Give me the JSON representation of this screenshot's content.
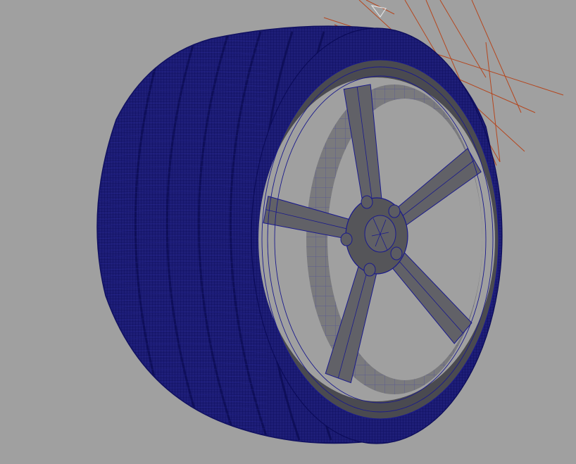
{
  "viewport": {
    "background_color": "#a0a0a0",
    "wireframe_color": "#1a1a8c",
    "surface_color": "#5a5a5e",
    "surface_dark_color": "#3c3c40",
    "guide_line_color": "#b5461e"
  },
  "scene": {
    "object": "wheel-with-tire",
    "display_mode": "wireframe-on-shaded",
    "spoke_count": 5,
    "lug_nut_count": 5
  }
}
